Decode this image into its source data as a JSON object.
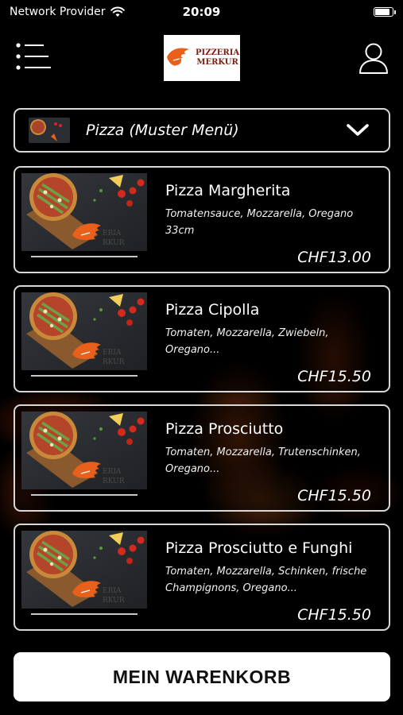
{
  "status_bar": {
    "carrier": "Network Provider",
    "time": "20:09"
  },
  "header": {
    "logo_line1": "PIZZERIA",
    "logo_line2": "MERKUR"
  },
  "category_selector": {
    "label": "Pizza (Muster Menü)"
  },
  "items": [
    {
      "name": "Pizza Margherita",
      "description": "Tomatensauce, Mozzarella, Oregano 33cm",
      "price": "CHF13.00"
    },
    {
      "name": "Pizza Cipolla",
      "description": "Tomaten, Mozzarella, Zwiebeln, Oregano...",
      "price": "CHF15.50"
    },
    {
      "name": "Pizza Prosciutto",
      "description": "Tomaten, Mozzarella, Trutenschinken, Oregano...",
      "price": "CHF15.50"
    },
    {
      "name": "Pizza Prosciutto e Funghi",
      "description": "Tomaten, Mozzarella, Schinken, frische Champignons, Oregano...",
      "price": "CHF15.50"
    }
  ],
  "cart_button": {
    "label": "MEIN WARENKORB"
  },
  "colors": {
    "background": "#000000",
    "border": "#d8d8d8",
    "logo_accent": "#e8601c"
  },
  "icons": [
    "wifi-icon",
    "battery-icon",
    "menu-icon",
    "user-icon",
    "chevron-down-icon"
  ]
}
